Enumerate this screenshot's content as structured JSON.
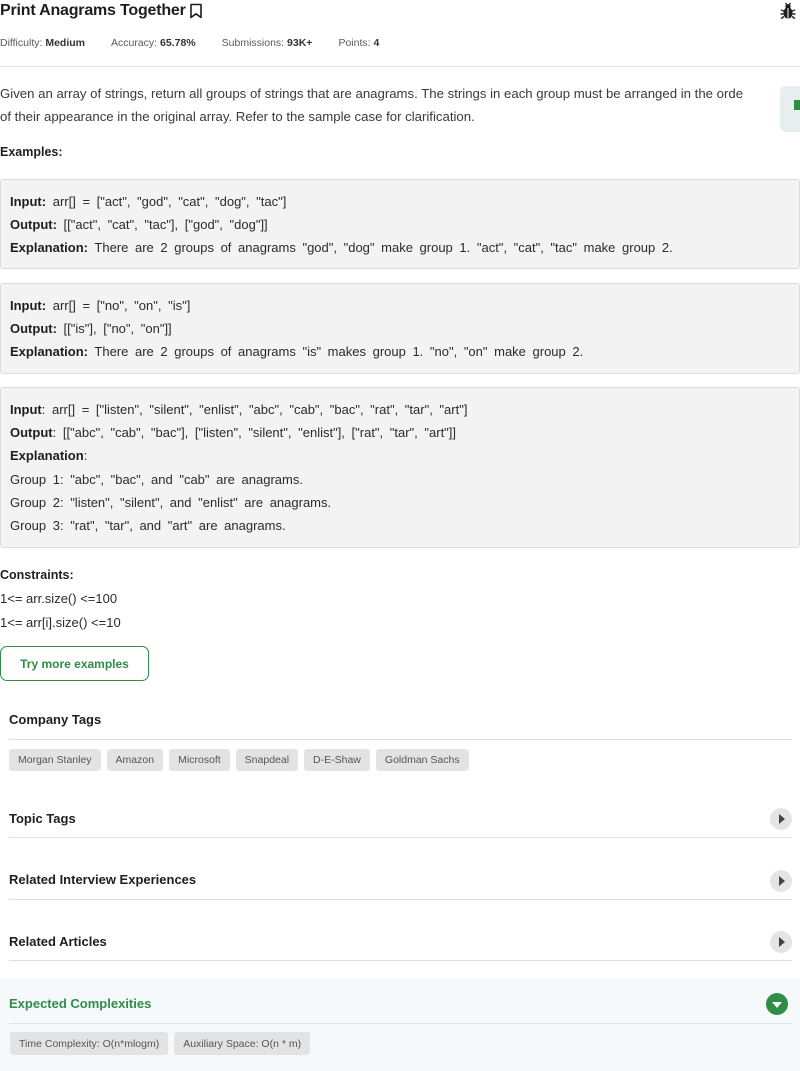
{
  "header": {
    "title": "Print Anagrams Together",
    "difficulty_label": "Difficulty:",
    "difficulty": "Medium",
    "accuracy_label": "Accuracy:",
    "accuracy": "65.78%",
    "submissions_label": "Submissions:",
    "submissions": "93K+",
    "points_label": "Points:",
    "points": "4"
  },
  "description": {
    "line1": "Given an array of strings, return all groups of strings that are anagrams. The strings in each group must be arranged in the orde",
    "line2": "of their appearance in the original array. Refer to the sample case for clarification."
  },
  "examples_heading": "Examples:",
  "examples": [
    {
      "input_label": "Input:",
      "input": "arr[] = [\"act\", \"god\", \"cat\", \"dog\", \"tac\"]",
      "output_label": "Output:",
      "output": "[[\"act\", \"cat\", \"tac\"], [\"god\", \"dog\"]]",
      "explanation_label": "Explanation:",
      "explanation": "There are 2 groups of anagrams \"god\", \"dog\" make group 1. \"act\", \"cat\", \"tac\" make group 2."
    },
    {
      "input_label": "Input:",
      "input": "arr[] = [\"no\", \"on\", \"is\"]",
      "output_label": "Output:",
      "output": "[[\"is\"], [\"no\", \"on\"]]",
      "explanation_label": "Explanation:",
      "explanation": "There are 2 groups of anagrams \"is\" makes group 1. \"no\", \"on\" make group 2."
    },
    {
      "input_label": "Input",
      "input": "arr[] = [\"listen\", \"silent\", \"enlist\", \"abc\", \"cab\", \"bac\", \"rat\", \"tar\", \"art\"]",
      "output_label": "Output",
      "output": "[[\"abc\", \"cab\", \"bac\"], [\"listen\", \"silent\", \"enlist\"], [\"rat\", \"tar\", \"art\"]]",
      "explanation_label": "Explanation",
      "explanation_lines": [
        "Group 1: \"abc\", \"bac\", and \"cab\" are anagrams.",
        "Group 2: \"listen\", \"silent\", and \"enlist\" are anagrams.",
        "Group 3: \"rat\", \"tar\", and \"art\" are anagrams."
      ]
    }
  ],
  "constraints": {
    "heading": "Constraints:",
    "line1": "1<= arr.size() <=100",
    "line2": "1<= arr[i].size() <=10"
  },
  "try_button": "Try more examples",
  "company_tags": {
    "heading": "Company Tags",
    "tags": [
      "Morgan Stanley",
      "Amazon",
      "Microsoft",
      "Snapdeal",
      "D-E-Shaw",
      "Goldman Sachs"
    ]
  },
  "sections": {
    "topic_tags": "Topic Tags",
    "interview": "Related Interview Experiences",
    "articles": "Related Articles",
    "complexities": "Expected Complexities"
  },
  "complexities": {
    "time": "Time Complexity: O(n*mlogm)",
    "space": "Auxiliary Space: O(n * m)"
  },
  "colors": {
    "accent": "#2f8d46",
    "example_bg": "#f3f3f3",
    "tag_bg": "#e3e3e3"
  },
  "icons": [
    "bookmark-icon",
    "bug-report-icon",
    "chevron-right-icon",
    "chevron-down-icon"
  ]
}
